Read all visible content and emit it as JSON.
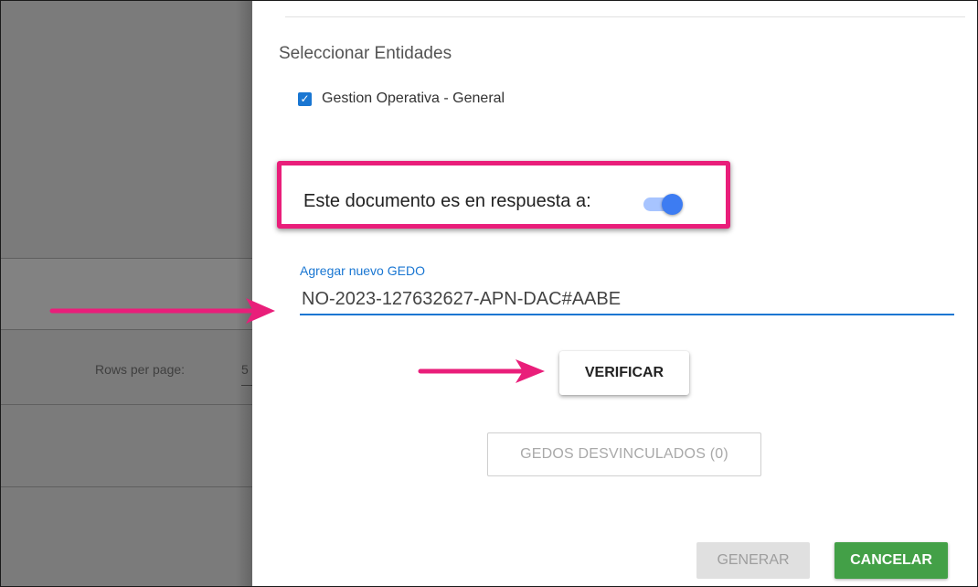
{
  "background_page": {
    "rows_per_page_label": "Rows per page:",
    "rows_per_page_value": "5"
  },
  "dialog": {
    "section_title": "Seleccionar Entidades",
    "entity_checkbox": {
      "label": "Gestion Operativa - General",
      "checked": true
    },
    "response_toggle": {
      "label": "Este documento es en respuesta a:",
      "on": true
    },
    "gedo_field": {
      "label": "Agregar nuevo GEDO",
      "value": "NO-2023-127632627-APN-DAC#AABE"
    },
    "verify_button": "VERIFICAR",
    "unlinked_button": "GEDOS DESVINCULADOS (0)",
    "generate_button": "GENERAR",
    "cancel_button": "CANCELAR"
  },
  "colors": {
    "annotation": "#e91e7a",
    "primary": "#1976d2",
    "toggle_thumb": "#3d7cf2",
    "toggle_track": "#a7c4ff",
    "cancel_green": "#43a047",
    "backdrop": "#7b7b7b"
  },
  "icons": {
    "checkbox": "check-icon",
    "annotation_arrows": "arrow-right-icon"
  }
}
